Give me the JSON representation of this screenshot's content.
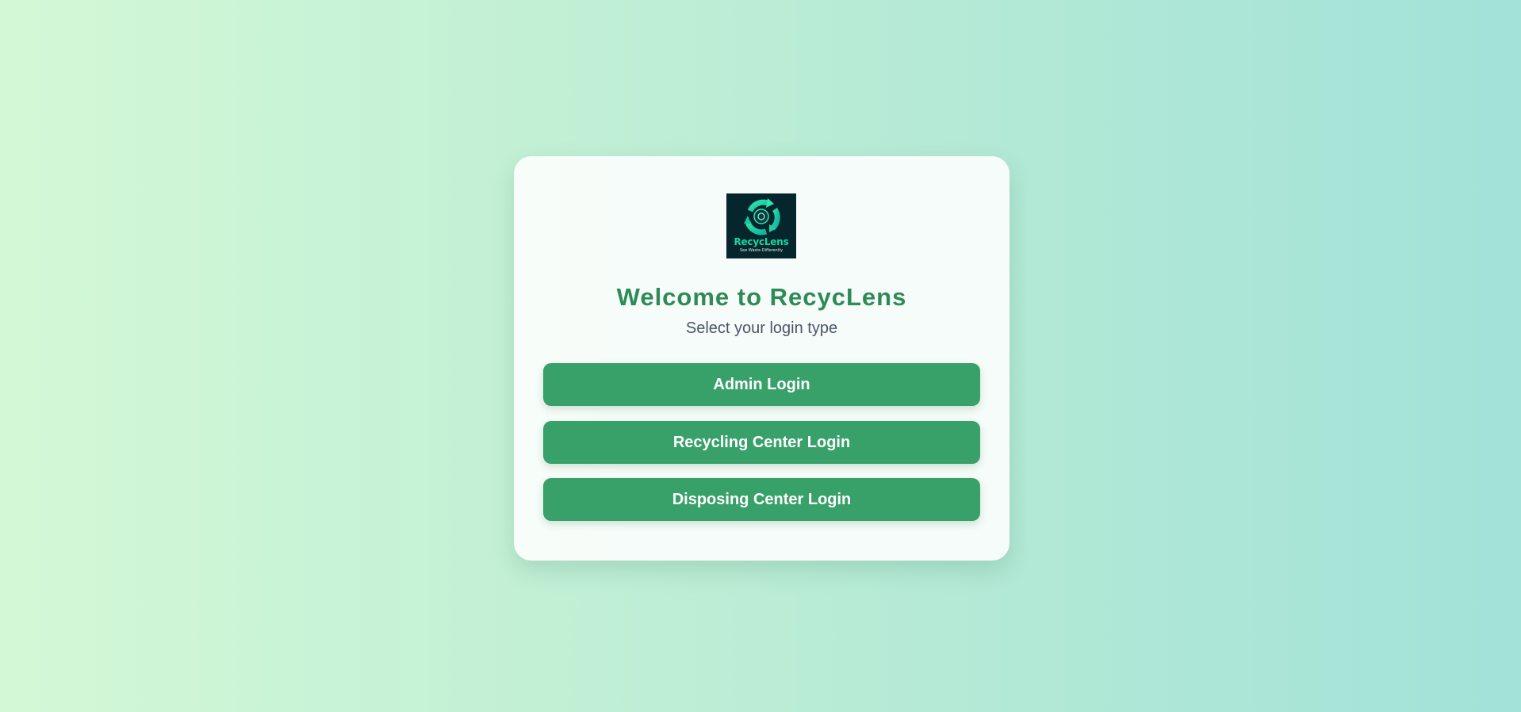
{
  "brand": {
    "logo_name": "RecycLens",
    "logo_tagline": "See Waste Differently",
    "colors": {
      "logo_bg": "#06262e",
      "logo_accent": "#16d6a4",
      "title": "#2e8b57",
      "button": "#38a169"
    }
  },
  "card": {
    "title": "Welcome to RecycLens",
    "subtitle": "Select your login type"
  },
  "buttons": {
    "admin": "Admin Login",
    "recycling": "Recycling Center Login",
    "disposing": "Disposing Center Login"
  }
}
